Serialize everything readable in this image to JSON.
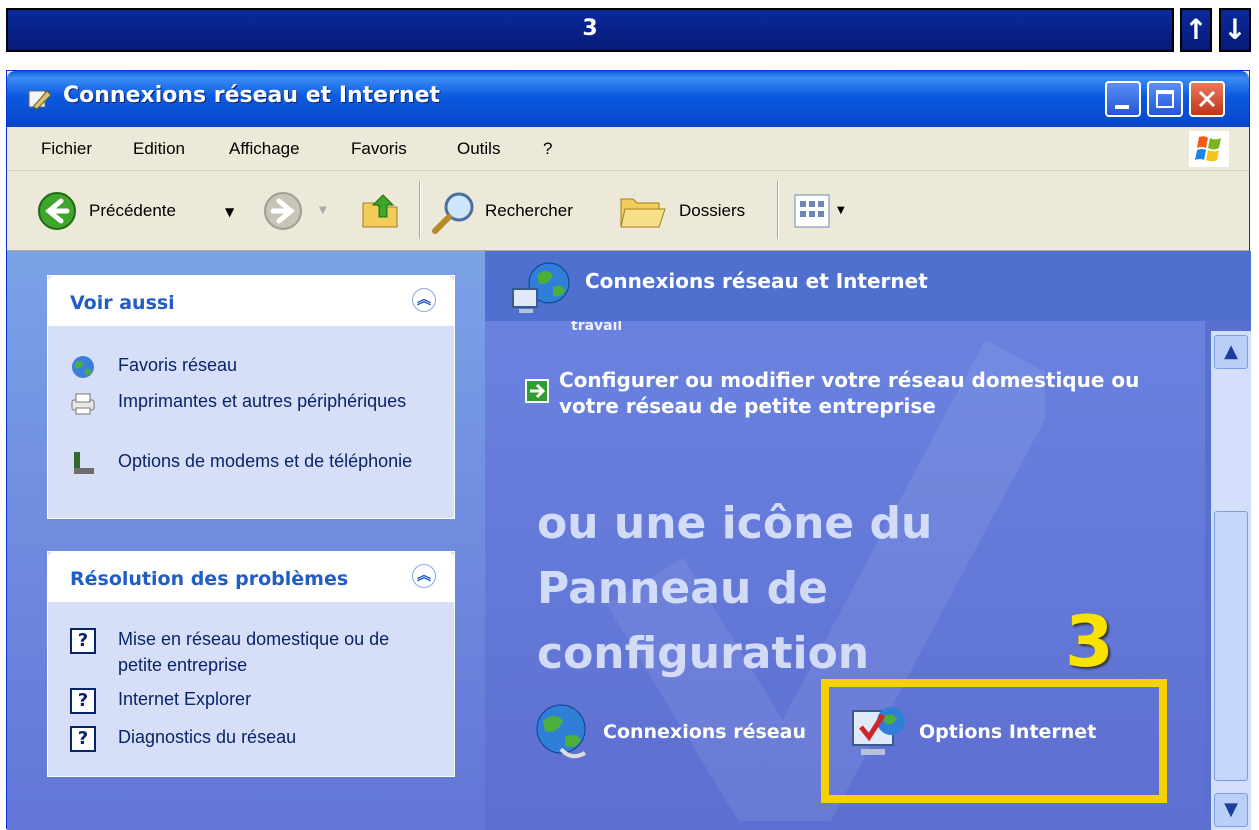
{
  "step_bar": {
    "step": "3",
    "up_label": "↑",
    "down_label": "↓"
  },
  "window": {
    "title": "Connexions réseau et Internet",
    "menu": [
      "Fichier",
      "Edition",
      "Affichage",
      "Favoris",
      "Outils",
      "?"
    ],
    "toolbar": {
      "back": "Précédente",
      "search": "Rechercher",
      "folders": "Dossiers"
    }
  },
  "see_also": {
    "title": "Voir aussi",
    "items": [
      {
        "label": "Favoris réseau",
        "icon": "globe-network-icon"
      },
      {
        "label": "Imprimantes et autres périphériques",
        "icon": "printer-icon"
      },
      {
        "label": "Options de modems et de téléphonie",
        "icon": "phone-icon"
      }
    ]
  },
  "troubleshoot": {
    "title": "Résolution des problèmes",
    "items": [
      {
        "label": "Mise en réseau domestique ou de petite entreprise",
        "icon": "help-icon"
      },
      {
        "label": "Internet Explorer",
        "icon": "help-icon"
      },
      {
        "label": "Diagnostics du réseau",
        "icon": "help-icon"
      }
    ]
  },
  "main": {
    "header": "Connexions réseau et Internet",
    "partial_text": "travail",
    "task_link": "Configurer ou modifier votre réseau domestique ou votre réseau de petite entreprise",
    "overlay_lines": [
      "ou une icône du",
      "Panneau de",
      "configuration"
    ],
    "step_marker": "3",
    "cp_icons": [
      {
        "label": "Connexions réseau",
        "icon": "network-connections-icon"
      },
      {
        "label": "Options Internet",
        "icon": "internet-options-icon"
      }
    ]
  }
}
